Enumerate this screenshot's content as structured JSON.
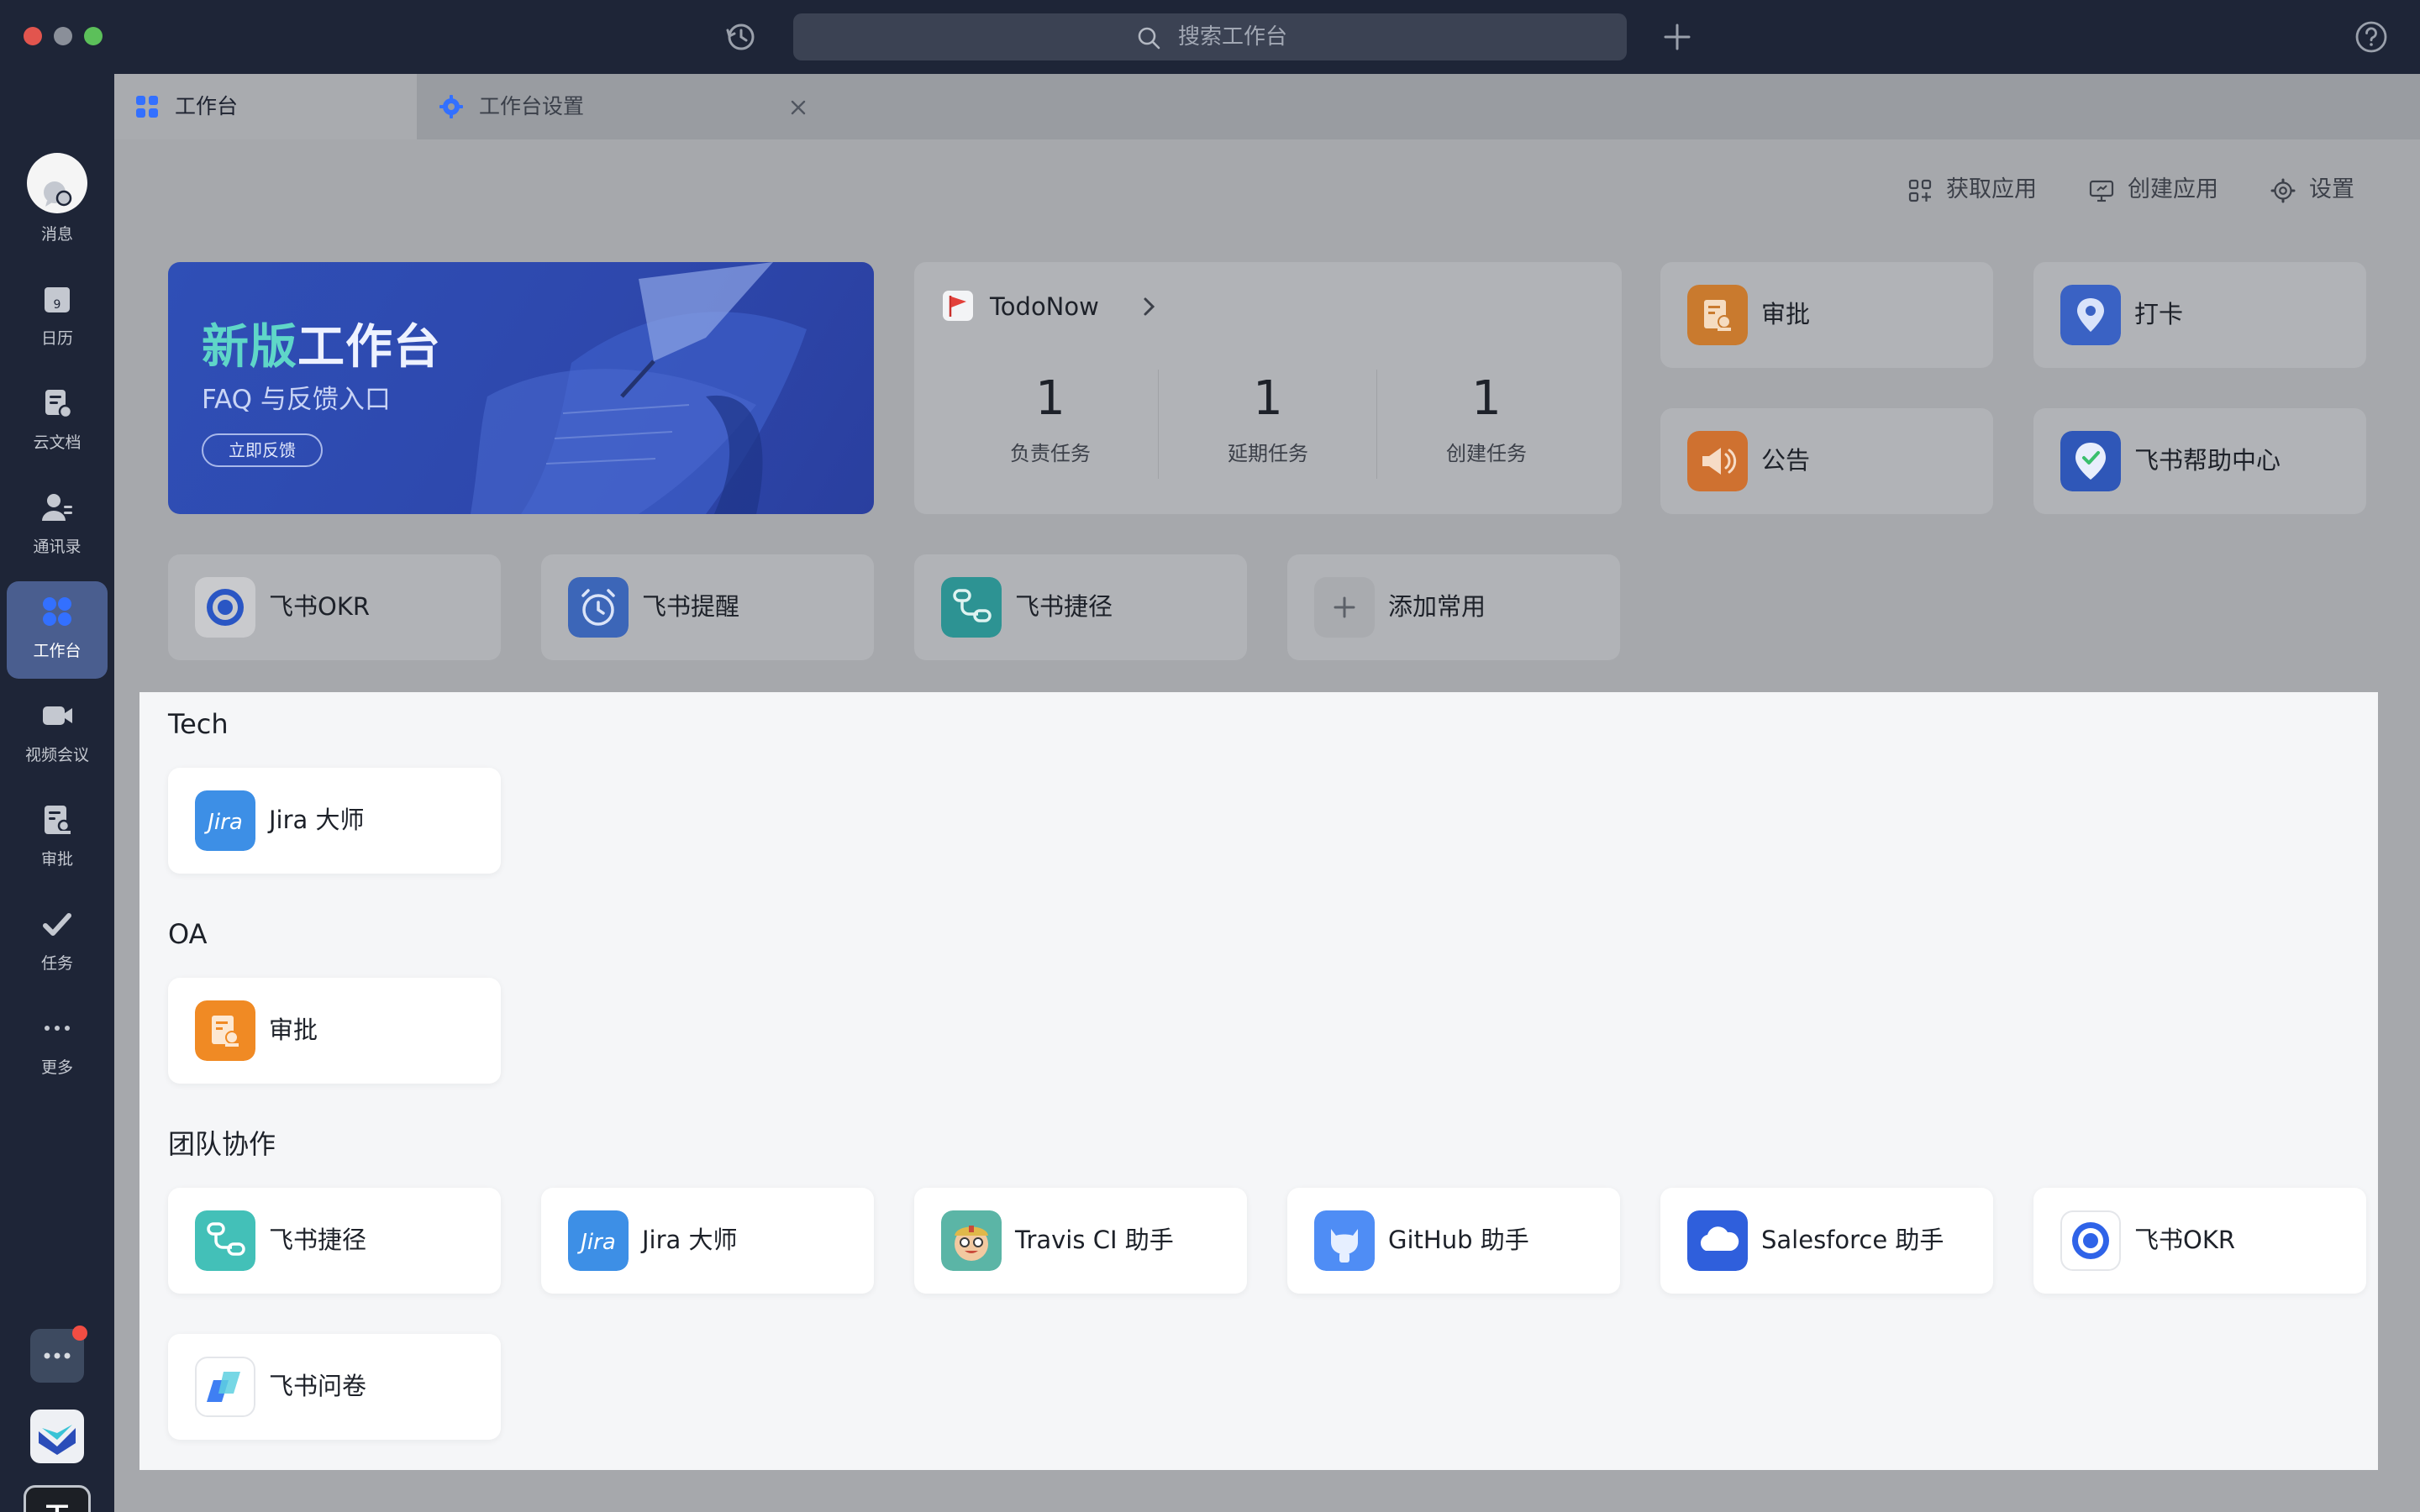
{
  "search": {
    "placeholder": "搜索工作台"
  },
  "rail": {
    "items": [
      {
        "label": "消息"
      },
      {
        "label": "日历"
      },
      {
        "label": "云文档"
      },
      {
        "label": "通讯录"
      },
      {
        "label": "工作台"
      },
      {
        "label": "视频会议"
      },
      {
        "label": "审批"
      },
      {
        "label": "任务"
      },
      {
        "label": "更多"
      }
    ],
    "calendar_day": "9",
    "bottom_app_letter": "T"
  },
  "tabs": [
    {
      "label": "工作台"
    },
    {
      "label": "工作台设置"
    }
  ],
  "actions": {
    "get_app": "获取应用",
    "create_app": "创建应用",
    "settings": "设置"
  },
  "banner": {
    "title_highlight": "新版",
    "title_rest": "工作台",
    "subtitle": "FAQ 与反馈入口",
    "button": "立即反馈"
  },
  "todo": {
    "title": "TodoNow",
    "stats": [
      {
        "value": "1",
        "label": "负责任务"
      },
      {
        "value": "1",
        "label": "延期任务"
      },
      {
        "value": "1",
        "label": "创建任务"
      }
    ]
  },
  "quick_apps": [
    {
      "name": "审批"
    },
    {
      "name": "打卡"
    },
    {
      "name": "公告"
    },
    {
      "name": "飞书帮助中心"
    }
  ],
  "favorites": [
    {
      "name": "飞书OKR"
    },
    {
      "name": "飞书提醒"
    },
    {
      "name": "飞书捷径"
    },
    {
      "name": "添加常用"
    }
  ],
  "sections": {
    "tech": {
      "title": "Tech",
      "apps": [
        {
          "name": "Jira 大师"
        }
      ]
    },
    "oa": {
      "title": "OA",
      "apps": [
        {
          "name": "审批"
        }
      ]
    },
    "team": {
      "title": "团队协作",
      "apps": [
        {
          "name": "飞书捷径"
        },
        {
          "name": "Jira 大师"
        },
        {
          "name": "Travis CI 助手"
        },
        {
          "name": "GitHub 助手"
        },
        {
          "name": "Salesforce 助手"
        },
        {
          "name": "飞书OKR"
        },
        {
          "name": "飞书问卷"
        }
      ]
    }
  },
  "icon_text": {
    "jira": "Jira"
  },
  "colors": {
    "accent": "#3370ff",
    "rail_bg": "#1e2537",
    "approval_orange": "#f08a24",
    "banner_blue": "#2f4fb6",
    "banner_highlight": "#5fd6c8"
  }
}
